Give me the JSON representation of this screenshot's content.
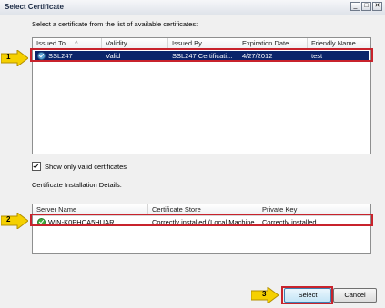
{
  "window": {
    "title": "Select Certificate",
    "controls": [
      "_",
      "□",
      "✕"
    ]
  },
  "instructions": "Select a certificate from the list of available certificates:",
  "certificates": {
    "columns": [
      "Issued To",
      "Validity",
      "Issued By",
      "Expiration Date",
      "Friendly Name"
    ],
    "sort_indicator": "^",
    "rows": [
      {
        "issued_to": "SSL247",
        "validity": "Valid",
        "issued_by": "SSL247 Certificati...",
        "expiration": "4/27/2012",
        "friendly_name": "test",
        "icon": "certificate-valid-icon",
        "selected": true
      }
    ]
  },
  "show_valid_only": {
    "label": "Show only valid certificates",
    "checked": true
  },
  "installation": {
    "title": "Certificate Installation Details:",
    "columns": [
      "Server Name",
      "Certificate Store",
      "Private Key"
    ],
    "rows": [
      {
        "server_name": "WIN-K0PHCA5HUAR",
        "store": "Correctly installed (Local Machine,...",
        "private_key": "Correctly installed",
        "icon": "status-ok-icon"
      }
    ]
  },
  "buttons": {
    "select": "Select",
    "cancel": "Cancel"
  },
  "annotations": {
    "step1": "1",
    "step2": "2",
    "step3": "3",
    "highlight_color": "#c8232c",
    "arrow_color": "#f5d000"
  }
}
